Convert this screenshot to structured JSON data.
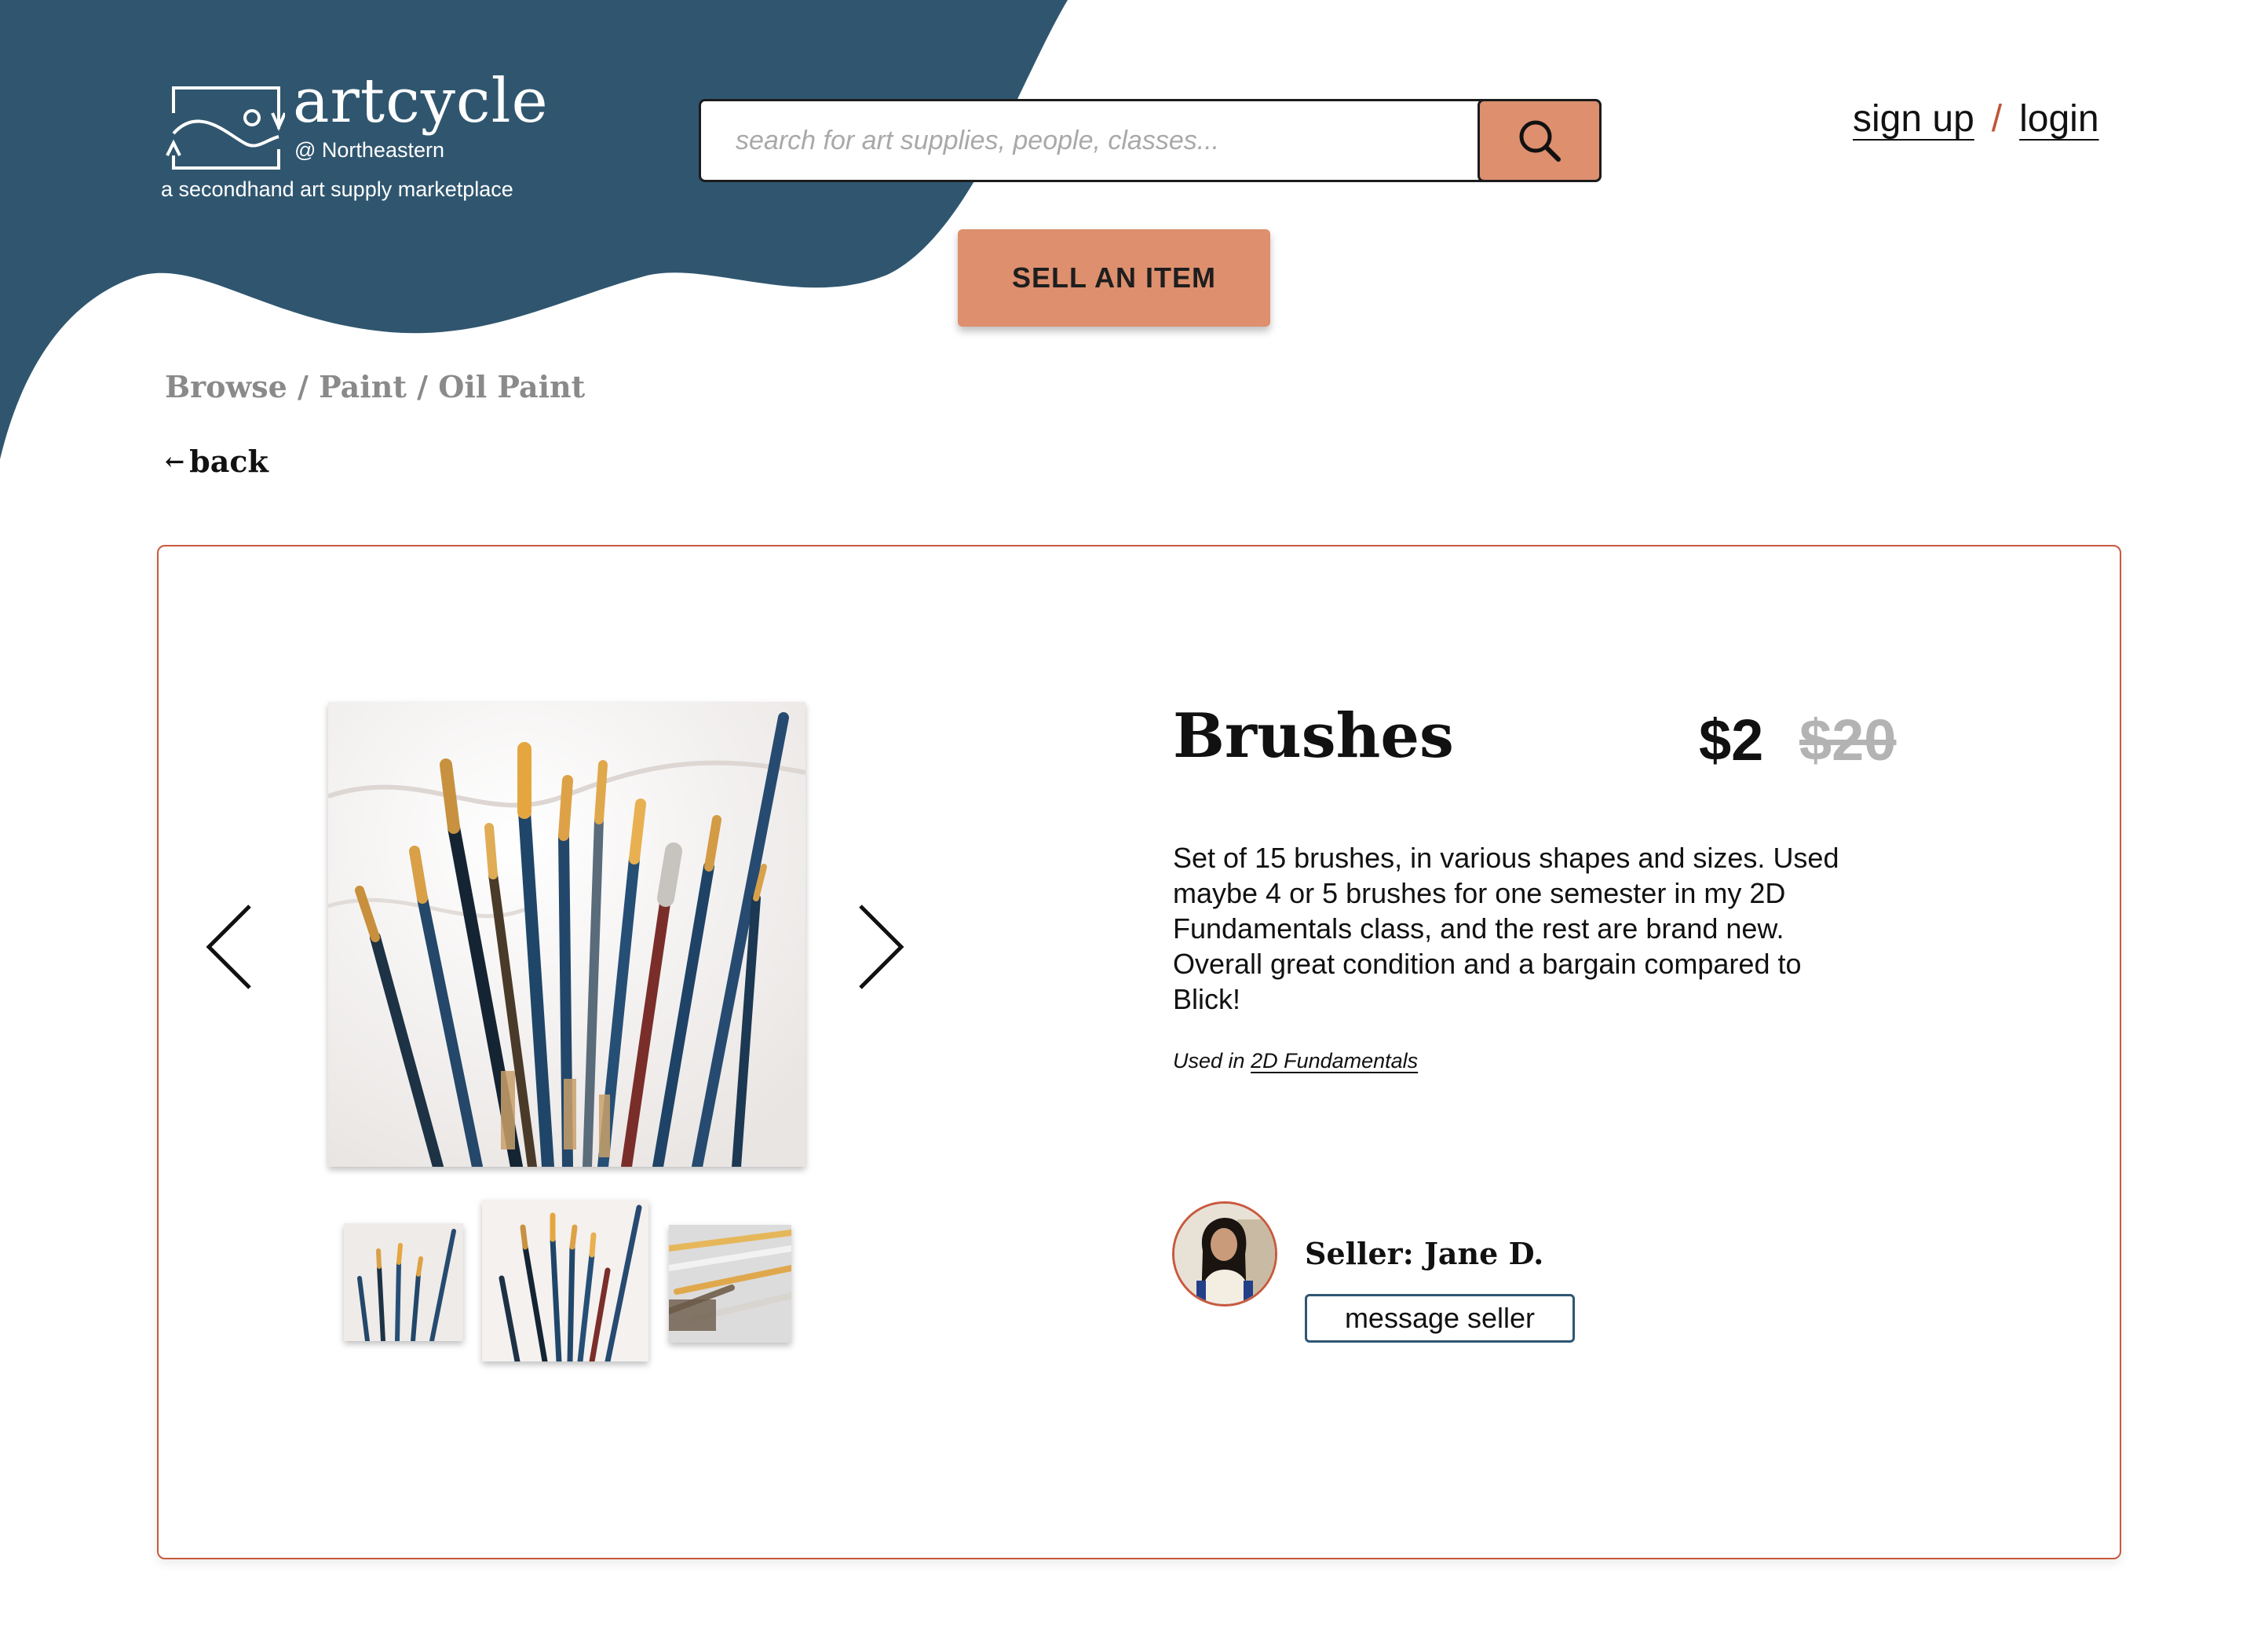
{
  "brand": {
    "name": "artcycle",
    "location": "@ Northeastern",
    "tagline": "a secondhand art supply marketplace",
    "primary_color": "#30566f",
    "accent_color": "#dd8f6e"
  },
  "header": {
    "search_placeholder": "search for art supplies, people, classes...",
    "search_icon": "search-icon",
    "signup_label": "sign up",
    "separator": "/",
    "login_label": "login",
    "sell_label": "SELL AN ITEM"
  },
  "breadcrumb": "Browse / Paint / Oil Paint",
  "back_label": "back",
  "listing": {
    "title": "Brushes",
    "price": "$2",
    "original_price": "$20",
    "description": "Set of 15 brushes, in various shapes and sizes. Used maybe 4 or 5 brushes for one semester in my 2D Fundamentals class, and the rest are brand new. Overall great condition and a bargain compared to Blick!",
    "used_in_prefix": "Used in",
    "used_in_class": "2D Fundamentals",
    "seller_label": "Seller: Jane D.",
    "message_label": "message seller"
  }
}
